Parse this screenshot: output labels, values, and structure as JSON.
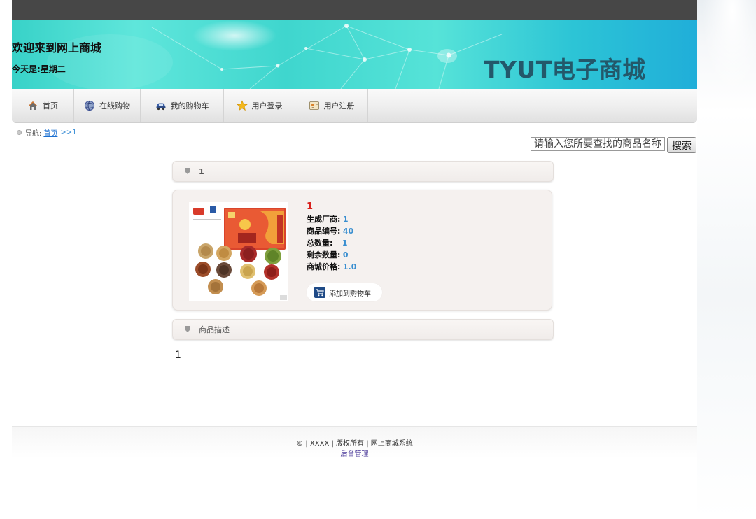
{
  "header": {
    "welcome": "欢迎来到网上商城",
    "today": "今天是:星期二",
    "brand": "TYUT电子商城"
  },
  "nav": {
    "items": [
      {
        "label": "首页",
        "icon": "home-icon"
      },
      {
        "label": "在线购物",
        "icon": "globe-icon"
      },
      {
        "label": "我的购物车",
        "icon": "car-icon"
      },
      {
        "label": "用户登录",
        "icon": "star-icon"
      },
      {
        "label": "用户注册",
        "icon": "id-card-icon"
      }
    ]
  },
  "breadcrumb": {
    "prefix": "导航:",
    "home_link": "首页",
    "current": ">>1"
  },
  "search": {
    "placeholder": "请输入您所要查找的商品名称",
    "button": "搜索"
  },
  "product_section": {
    "title": "1"
  },
  "product": {
    "name": "1",
    "manufacturer_label": "生成厂商:",
    "manufacturer": "1",
    "code_label": "商品编号:",
    "code": "40",
    "total_label": "总数量:",
    "total": "1",
    "remaining_label": "剩余数量:",
    "remaining": "0",
    "price_label": "商城价格:",
    "price": "1.0",
    "add_to_cart": "添加到购物车"
  },
  "description_section": {
    "title": "商品描述",
    "body": "1"
  },
  "footer": {
    "copyright": "© | XXXX | 版权所有 | 网上商城系统",
    "admin_link": "后台管理"
  },
  "colors": {
    "topbar": "#474747",
    "banner_teal": "#3fd6ce",
    "brand_text": "#23586a",
    "product_name": "#d9201c",
    "value_blue": "#3a8fd0"
  }
}
